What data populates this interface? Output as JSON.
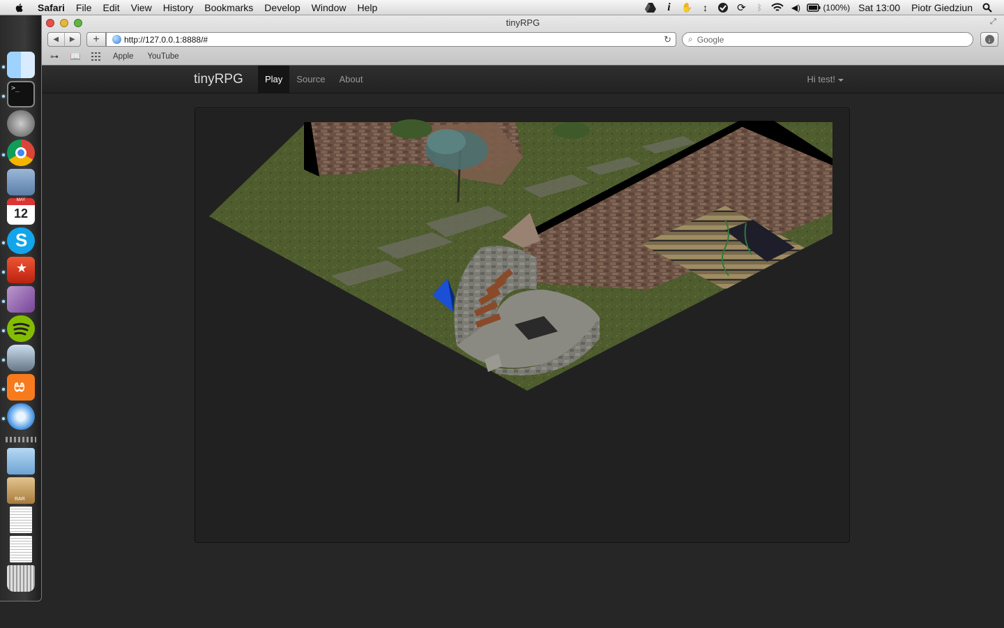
{
  "menubar": {
    "app_name": "Safari",
    "menus": [
      "File",
      "Edit",
      "View",
      "History",
      "Bookmarks",
      "Develop",
      "Window",
      "Help"
    ],
    "battery": "(100%)",
    "clock": "Sat 13:00",
    "user": "Piotr Giedziun",
    "status_icons": [
      "google-drive-icon",
      "info-icon",
      "hand-icon",
      "arrows-icon",
      "growl-icon",
      "sync-icon",
      "bluetooth-icon",
      "wifi-icon",
      "volume-icon",
      "battery-icon",
      "spotlight-icon"
    ]
  },
  "dock": {
    "items": [
      "finder",
      "terminal",
      "launchpad",
      "chrome",
      "preview",
      "calendar",
      "skype",
      "wunderlist",
      "apps",
      "spotify",
      "automator",
      "xampp",
      "safari",
      "folder",
      "rar-archive",
      "document",
      "document",
      "trash"
    ],
    "calendar_day": "12",
    "calendar_month": "MAY",
    "rar_label": "RAR"
  },
  "browser": {
    "window_title": "tinyRPG",
    "url": "http://127.0.0.1:8888/#",
    "search_placeholder": "Google",
    "bookmarks": [
      "Apple",
      "YouTube"
    ]
  },
  "site": {
    "brand": "tinyRPG",
    "nav": [
      {
        "label": "Play",
        "active": true
      },
      {
        "label": "Source",
        "active": false
      },
      {
        "label": "About",
        "active": false
      }
    ],
    "user_greeting": "Hi test!"
  },
  "colors": {
    "grass": "#4c5a2c",
    "path": "#6b6b63",
    "wall": "#6e5446",
    "player": "#1a4fd6"
  }
}
